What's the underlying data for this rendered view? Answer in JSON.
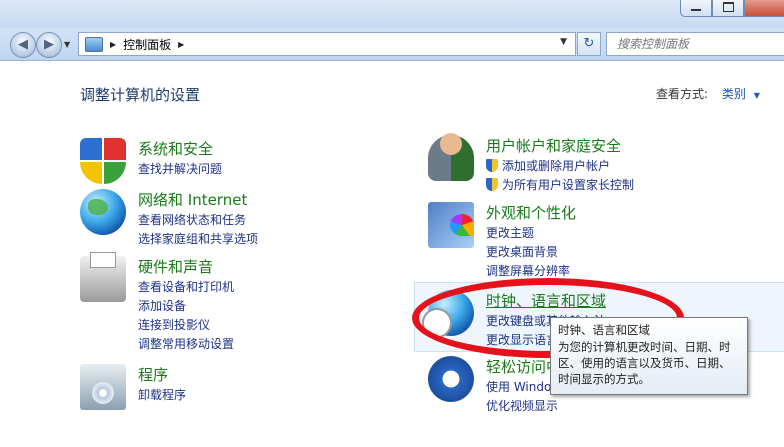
{
  "address_bar": {
    "path": "控制面板",
    "search_placeholder": "搜索控制面板"
  },
  "content": {
    "title": "调整计算机的设置",
    "view_by_label": "查看方式:",
    "view_by_value": "类别"
  },
  "categories_left": [
    {
      "title": "系统和安全",
      "icon": "security-shield-icon",
      "links": [
        "查找并解决问题"
      ]
    },
    {
      "title": "网络和 Internet",
      "icon": "network-globe-icon",
      "links": [
        "查看网络状态和任务",
        "选择家庭组和共享选项"
      ]
    },
    {
      "title": "硬件和声音",
      "icon": "printer-icon",
      "links": [
        "查看设备和打印机",
        "添加设备",
        "连接到投影仪",
        "调整常用移动设置"
      ]
    },
    {
      "title": "程序",
      "icon": "program-disc-icon",
      "links": [
        "卸载程序"
      ]
    }
  ],
  "categories_right": [
    {
      "title": "用户帐户和家庭安全",
      "icon": "users-icon",
      "links": [
        "添加或删除用户帐户",
        "为所有用户设置家长控制"
      ]
    },
    {
      "title": "外观和个性化",
      "icon": "appearance-icon",
      "links": [
        "更改主题",
        "更改桌面背景",
        "调整屏幕分辨率"
      ]
    },
    {
      "title": "时钟、语言和区域",
      "icon": "clock-globe-icon",
      "links": [
        "更改键盘或其他输入法",
        "更改显示语言"
      ]
    },
    {
      "title": "轻松访问中心",
      "icon": "ease-of-access-icon",
      "links": [
        "使用 Windows 建议的设置",
        "优化视频显示"
      ]
    }
  ],
  "tooltip": {
    "title": "时钟、语言和区域",
    "description": "为您的计算机更改时间、日期、时区、使用的语言以及货币、日期、时间显示的方式。"
  }
}
